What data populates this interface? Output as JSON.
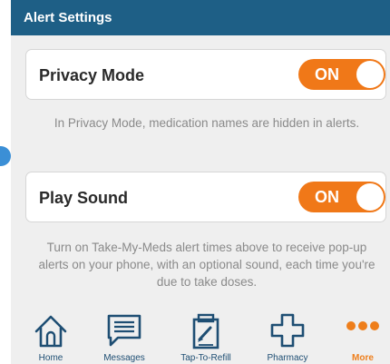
{
  "header": {
    "title": "Alert Settings"
  },
  "privacy": {
    "label": "Privacy Mode",
    "toggle": "ON",
    "note": "In Privacy Mode, medication names are hidden in alerts."
  },
  "sound": {
    "label": "Play Sound",
    "toggle": "ON",
    "note": "Turn on Take-My-Meds alert times above to receive pop-up alerts on your phone, with an optional sound, each time you're due to take doses."
  },
  "tabs": [
    {
      "label": "Home",
      "icon": "home-icon"
    },
    {
      "label": "Messages",
      "icon": "messages-icon"
    },
    {
      "label": "Tap-To-Refill",
      "icon": "refill-icon"
    },
    {
      "label": "Pharmacy",
      "icon": "pharmacy-icon"
    },
    {
      "label": "More",
      "icon": "more-icon"
    }
  ],
  "colors": {
    "header": "#1e5f86",
    "toggle_on": "#f07818",
    "tab_icon": "#1e4e73",
    "tab_active": "#ee7e1b"
  }
}
